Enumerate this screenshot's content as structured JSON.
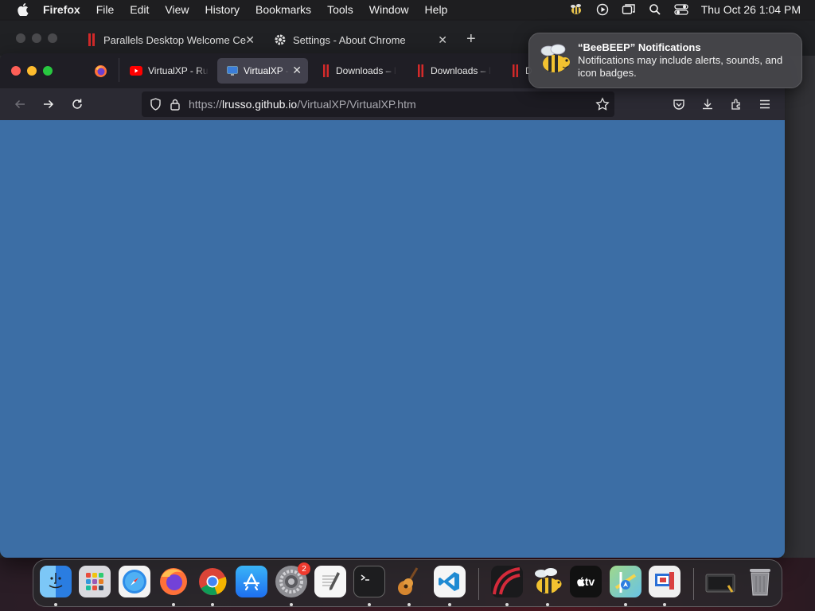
{
  "menubar": {
    "app_name": "Firefox",
    "items": [
      "File",
      "Edit",
      "View",
      "History",
      "Bookmarks",
      "Tools",
      "Window",
      "Help"
    ],
    "clock": "Thu Oct 26  1:04 PM"
  },
  "chrome_window": {
    "tabs": [
      {
        "title": "Parallels Desktop Welcome Ce",
        "icon": "parallels-icon"
      },
      {
        "title": "Settings - About Chrome",
        "icon": "gear-icon"
      }
    ],
    "new_tab_label": "+"
  },
  "firefox": {
    "tabs": [
      {
        "title": "VirtualXP - Ru",
        "icon": "youtube-icon",
        "active": false
      },
      {
        "title": "VirtualXP -",
        "icon": "monitor-icon",
        "active": true
      },
      {
        "title": "Downloads – I",
        "icon": "parallels-icon",
        "active": false
      },
      {
        "title": "Downloads – I",
        "icon": "parallels-icon",
        "active": false
      },
      {
        "title": "D",
        "icon": "parallels-icon",
        "active": false
      }
    ],
    "url": {
      "prefix": "https://",
      "domain": "lrusso.github.io",
      "path": "/VirtualXP/VirtualXP.htm"
    },
    "content_color": "#3c6ea5"
  },
  "notification": {
    "title": "“BeeBEEP” Notifications",
    "body": "Notifications may include alerts, sounds, and icon badges."
  },
  "dock": {
    "apps": [
      {
        "name": "Finder",
        "icon": "finder-icon"
      },
      {
        "name": "Launchpad",
        "icon": "launchpad-icon"
      },
      {
        "name": "Safari",
        "icon": "safari-icon"
      },
      {
        "name": "Firefox",
        "icon": "firefox-icon"
      },
      {
        "name": "Chrome",
        "icon": "chrome-icon"
      },
      {
        "name": "App Store",
        "icon": "appstore-icon"
      },
      {
        "name": "System Settings",
        "icon": "settings-icon",
        "badge": "2"
      },
      {
        "name": "TextEdit",
        "icon": "textedit-icon"
      },
      {
        "name": "Terminal",
        "icon": "terminal-icon"
      },
      {
        "name": "GarageBand",
        "icon": "guitar-icon"
      },
      {
        "name": "VS Code",
        "icon": "vscode-icon"
      },
      {
        "name": "Parallels",
        "icon": "parallels-icon"
      },
      {
        "name": "BeeBEEP",
        "icon": "bee-icon"
      },
      {
        "name": "Apple TV",
        "icon": "appletv-icon"
      },
      {
        "name": "Maps",
        "icon": "maps-icon"
      },
      {
        "name": "Remote Desktop",
        "icon": "remote-icon"
      },
      {
        "name": "Screenshot",
        "icon": "screenshot-icon"
      },
      {
        "name": "Trash",
        "icon": "trash-icon"
      }
    ],
    "tv_label": "tv"
  }
}
